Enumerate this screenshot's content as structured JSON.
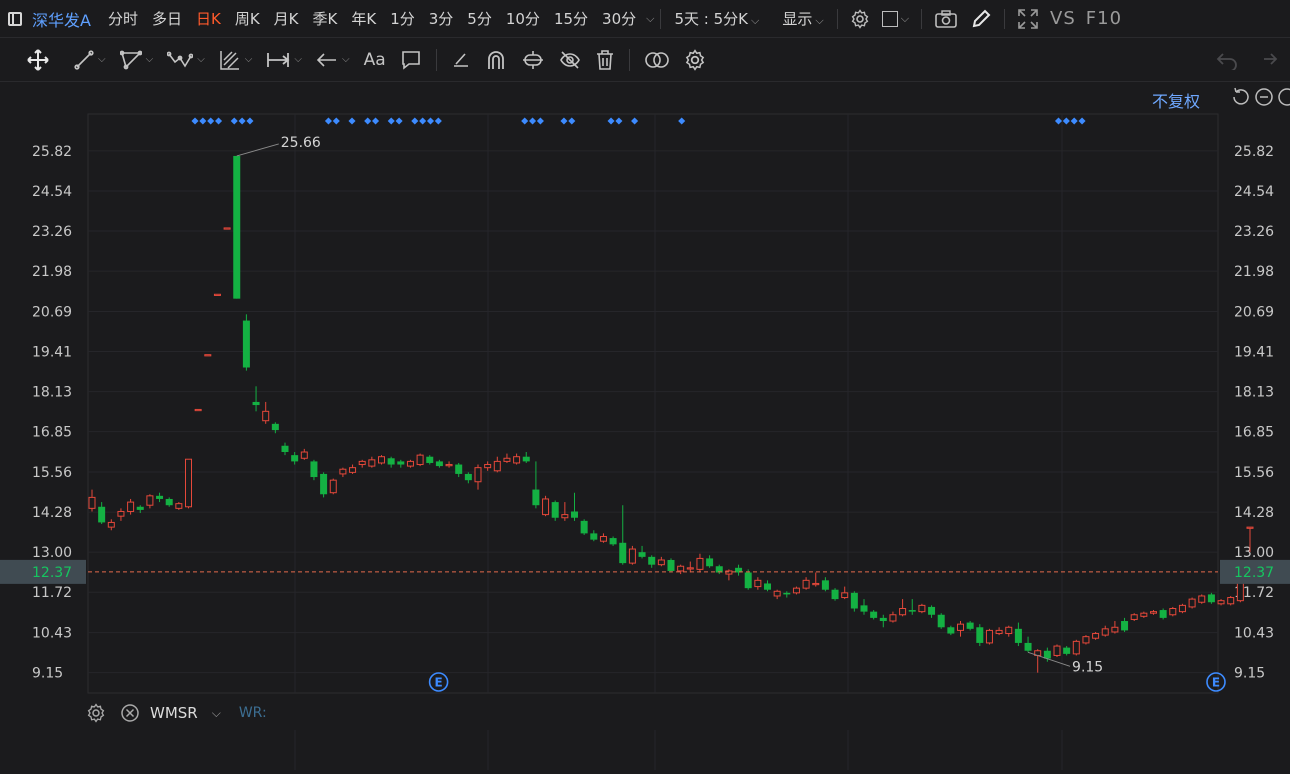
{
  "header": {
    "stock_name": "深华发A",
    "periods": [
      {
        "label": "分时",
        "active": false
      },
      {
        "label": "多日",
        "active": false
      },
      {
        "label": "日K",
        "active": true
      },
      {
        "label": "周K",
        "active": false
      },
      {
        "label": "月K",
        "active": false
      },
      {
        "label": "季K",
        "active": false
      },
      {
        "label": "年K",
        "active": false
      },
      {
        "label": "1分",
        "active": false
      },
      {
        "label": "3分",
        "active": false
      },
      {
        "label": "5分",
        "active": false
      },
      {
        "label": "10分",
        "active": false
      },
      {
        "label": "15分",
        "active": false
      },
      {
        "label": "30分",
        "active": false
      }
    ],
    "multi_period": "5天 : 5分K",
    "display_label": "显示",
    "vs_label": "VS",
    "f10_label": "F10"
  },
  "toolbar": {
    "icons": [
      "move-icon",
      "line-segment-icon",
      "polygon-icon",
      "wave-icon",
      "channel-icon",
      "measure-icon",
      "arrow-icon",
      "text-icon",
      "comment-icon",
      "pen-icon",
      "arch-icon",
      "magnet-icon",
      "hide-icon",
      "trash-icon",
      "compare-icon",
      "settings-icon"
    ]
  },
  "chart": {
    "adjust_label": "不复权",
    "current_price": "12.37",
    "high_label": "25.66",
    "low_label": "9.15",
    "event_marker": "E",
    "colors": {
      "up": "#e5483a",
      "down": "#14b143",
      "price_line": "#e46a4c",
      "axis_text": "#c8c8c8",
      "diamond": "#3d8bff",
      "current_bg": "#404b52",
      "current_text": "#16c560"
    }
  },
  "chart_data": {
    "type": "candlestick",
    "ylim": [
      8.5,
      27.0
    ],
    "y_ticks": [
      "25.82",
      "24.54",
      "23.26",
      "21.98",
      "20.69",
      "19.41",
      "18.13",
      "16.85",
      "15.56",
      "14.28",
      "13.00",
      "11.72",
      "10.43",
      "9.15"
    ],
    "candles": [
      [
        14.4,
        14.75,
        15.0,
        14.3
      ],
      [
        14.45,
        13.95,
        14.6,
        13.9
      ],
      [
        13.8,
        13.95,
        14.05,
        13.7
      ],
      [
        14.15,
        14.3,
        14.4,
        14.0
      ],
      [
        14.3,
        14.6,
        14.7,
        14.2
      ],
      [
        14.45,
        14.35,
        14.5,
        14.25
      ],
      [
        14.5,
        14.8,
        14.85,
        14.4
      ],
      [
        14.8,
        14.7,
        14.9,
        14.6
      ],
      [
        14.7,
        14.5,
        14.75,
        14.45
      ],
      [
        14.4,
        14.55,
        14.6,
        14.35
      ],
      [
        14.45,
        15.97,
        15.97,
        14.4
      ],
      [
        17.56,
        17.56,
        17.56,
        17.56
      ],
      [
        19.31,
        19.31,
        19.31,
        19.31
      ],
      [
        21.24,
        21.24,
        21.24,
        21.24
      ],
      [
        23.36,
        23.36,
        23.36,
        23.36
      ],
      [
        25.66,
        21.1,
        25.66,
        21.1
      ],
      [
        20.4,
        18.9,
        20.6,
        18.8
      ],
      [
        17.8,
        17.7,
        18.3,
        17.5
      ],
      [
        17.2,
        17.5,
        17.8,
        17.1
      ],
      [
        17.1,
        16.9,
        17.15,
        16.8
      ],
      [
        16.4,
        16.2,
        16.5,
        16.1
      ],
      [
        16.1,
        15.9,
        16.2,
        15.8
      ],
      [
        16.0,
        16.2,
        16.3,
        15.95
      ],
      [
        15.9,
        15.4,
        15.95,
        15.3
      ],
      [
        15.5,
        14.85,
        15.55,
        14.75
      ],
      [
        14.9,
        15.3,
        15.35,
        14.85
      ],
      [
        15.5,
        15.65,
        15.7,
        15.4
      ],
      [
        15.55,
        15.7,
        15.8,
        15.5
      ],
      [
        15.8,
        15.9,
        15.95,
        15.7
      ],
      [
        15.75,
        15.95,
        16.05,
        15.7
      ],
      [
        15.85,
        16.05,
        16.1,
        15.8
      ],
      [
        16.0,
        15.8,
        16.05,
        15.7
      ],
      [
        15.9,
        15.8,
        15.95,
        15.7
      ],
      [
        15.75,
        15.9,
        15.95,
        15.7
      ],
      [
        15.8,
        16.1,
        16.15,
        15.75
      ],
      [
        16.05,
        15.85,
        16.1,
        15.8
      ],
      [
        15.9,
        15.75,
        15.95,
        15.7
      ],
      [
        15.8,
        15.8,
        15.9,
        15.7
      ],
      [
        15.8,
        15.5,
        15.85,
        15.4
      ],
      [
        15.5,
        15.3,
        15.55,
        15.2
      ],
      [
        15.25,
        15.7,
        15.8,
        15.0
      ],
      [
        15.7,
        15.8,
        15.9,
        15.6
      ],
      [
        15.6,
        15.9,
        16.05,
        15.55
      ],
      [
        15.9,
        16.0,
        16.15,
        15.85
      ],
      [
        15.85,
        16.05,
        16.15,
        15.8
      ],
      [
        16.05,
        15.9,
        16.2,
        15.85
      ],
      [
        15.0,
        14.5,
        15.9,
        14.4
      ],
      [
        14.2,
        14.7,
        14.8,
        14.15
      ],
      [
        14.6,
        14.1,
        14.65,
        14.0
      ],
      [
        14.1,
        14.2,
        14.6,
        14.0
      ],
      [
        14.3,
        14.1,
        14.9,
        14.0
      ],
      [
        14.0,
        13.6,
        14.05,
        13.55
      ],
      [
        13.6,
        13.4,
        13.7,
        13.35
      ],
      [
        13.35,
        13.5,
        13.6,
        13.3
      ],
      [
        13.45,
        13.25,
        13.5,
        13.2
      ],
      [
        13.3,
        12.65,
        14.5,
        12.6
      ],
      [
        12.65,
        13.1,
        13.2,
        12.6
      ],
      [
        13.0,
        12.85,
        13.2,
        12.8
      ],
      [
        12.85,
        12.6,
        12.9,
        12.5
      ],
      [
        12.6,
        12.75,
        12.85,
        12.55
      ],
      [
        12.75,
        12.4,
        12.8,
        12.35
      ],
      [
        12.4,
        12.55,
        12.6,
        12.3
      ],
      [
        12.5,
        12.5,
        12.7,
        12.35
      ],
      [
        12.45,
        12.8,
        12.95,
        12.35
      ],
      [
        12.8,
        12.55,
        12.9,
        12.5
      ],
      [
        12.55,
        12.35,
        12.6,
        12.3
      ],
      [
        12.3,
        12.4,
        12.45,
        12.1
      ],
      [
        12.5,
        12.35,
        12.6,
        12.25
      ],
      [
        12.35,
        11.85,
        12.45,
        11.8
      ],
      [
        11.9,
        12.1,
        12.2,
        11.8
      ],
      [
        12.0,
        11.8,
        12.1,
        11.75
      ],
      [
        11.6,
        11.75,
        11.8,
        11.5
      ],
      [
        11.7,
        11.65,
        11.75,
        11.55
      ],
      [
        11.7,
        11.85,
        11.9,
        11.65
      ],
      [
        11.85,
        12.1,
        12.2,
        11.8
      ],
      [
        12.0,
        12.0,
        12.35,
        11.9
      ],
      [
        12.1,
        11.8,
        12.2,
        11.75
      ],
      [
        11.8,
        11.5,
        11.85,
        11.45
      ],
      [
        11.55,
        11.7,
        11.9,
        11.5
      ],
      [
        11.7,
        11.2,
        11.75,
        11.1
      ],
      [
        11.3,
        11.1,
        11.5,
        11.0
      ],
      [
        11.1,
        10.9,
        11.15,
        10.85
      ],
      [
        10.9,
        10.8,
        11.0,
        10.6
      ],
      [
        10.8,
        11.0,
        11.1,
        10.75
      ],
      [
        11.0,
        11.2,
        11.5,
        10.95
      ],
      [
        11.15,
        11.1,
        11.5,
        11.0
      ],
      [
        11.1,
        11.3,
        11.35,
        11.05
      ],
      [
        11.25,
        11.0,
        11.3,
        10.9
      ],
      [
        11.0,
        10.6,
        11.05,
        10.55
      ],
      [
        10.6,
        10.4,
        10.65,
        10.35
      ],
      [
        10.5,
        10.7,
        10.8,
        10.3
      ],
      [
        10.75,
        10.55,
        10.8,
        10.5
      ],
      [
        10.6,
        10.1,
        10.7,
        10.0
      ],
      [
        10.1,
        10.5,
        10.55,
        10.05
      ],
      [
        10.4,
        10.5,
        10.6,
        10.35
      ],
      [
        10.4,
        10.6,
        10.65,
        10.3
      ],
      [
        10.55,
        10.1,
        10.75,
        10.0
      ],
      [
        10.1,
        9.85,
        10.3,
        9.8
      ],
      [
        9.7,
        9.85,
        9.9,
        9.15
      ],
      [
        9.85,
        9.6,
        9.95,
        9.5
      ],
      [
        9.7,
        10.0,
        10.05,
        9.65
      ],
      [
        9.95,
        9.75,
        10.0,
        9.7
      ],
      [
        9.75,
        10.15,
        10.2,
        9.7
      ],
      [
        10.1,
        10.3,
        10.35,
        10.05
      ],
      [
        10.25,
        10.4,
        10.45,
        10.2
      ],
      [
        10.35,
        10.55,
        10.65,
        10.3
      ],
      [
        10.45,
        10.6,
        10.8,
        10.4
      ],
      [
        10.8,
        10.5,
        10.9,
        10.45
      ],
      [
        10.85,
        11.0,
        11.05,
        10.8
      ],
      [
        10.95,
        11.05,
        11.1,
        10.9
      ],
      [
        11.05,
        11.1,
        11.15,
        11.0
      ],
      [
        11.15,
        10.9,
        11.2,
        10.85
      ],
      [
        11.0,
        11.2,
        11.25,
        10.95
      ],
      [
        11.1,
        11.3,
        11.35,
        11.05
      ],
      [
        11.25,
        11.5,
        11.55,
        11.2
      ],
      [
        11.4,
        11.6,
        11.65,
        11.35
      ],
      [
        11.65,
        11.4,
        11.7,
        11.35
      ],
      [
        11.35,
        11.45,
        11.5,
        11.3
      ],
      [
        11.35,
        11.55,
        11.6,
        11.3
      ],
      [
        11.45,
        12.5,
        12.5,
        11.4
      ],
      [
        13.8,
        13.8,
        13.8,
        13.0
      ],
      [
        12.55,
        12.37,
        12.6,
        12.3
      ]
    ],
    "dot_groups": [
      [
        0,
        1,
        2,
        3
      ],
      [
        5,
        6,
        7
      ],
      [
        17,
        18
      ],
      [
        20
      ],
      [
        22,
        23
      ],
      [
        25,
        26
      ],
      [
        28,
        29,
        30,
        31
      ],
      [
        42,
        43,
        44
      ],
      [
        47,
        48
      ],
      [
        53,
        54
      ],
      [
        56
      ],
      [
        62
      ],
      [
        110,
        111,
        112,
        113
      ]
    ],
    "event_indices": [
      36,
      120
    ],
    "high_index": 15,
    "low_index": 97,
    "last_index": 122
  },
  "indicator": {
    "name": "WMSR",
    "value_label": "WR:"
  }
}
